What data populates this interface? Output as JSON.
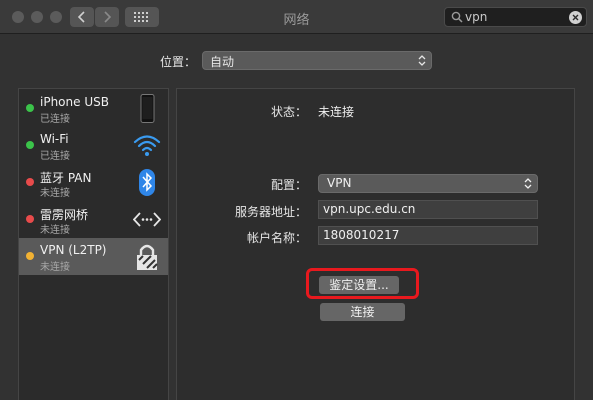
{
  "window": {
    "title": "网络",
    "search_value": "vpn"
  },
  "location": {
    "label": "位置：",
    "value": "自动"
  },
  "services": [
    {
      "name": "iPhone USB",
      "status": "已连接",
      "status_color": "#3bc34a",
      "icon": "iphone-icon"
    },
    {
      "name": "Wi-Fi",
      "status": "已连接",
      "status_color": "#3bc34a",
      "icon": "wifi-icon"
    },
    {
      "name": "蓝牙 PAN",
      "status": "未连接",
      "status_color": "#e84b4b",
      "icon": "bluetooth-icon"
    },
    {
      "name": "雷雳网桥",
      "status": "未连接",
      "status_color": "#e84b4b",
      "icon": "thunderbolt-bridge-icon"
    },
    {
      "name": "VPN (L2TP)",
      "status": "未连接",
      "status_color": "#f2b233",
      "icon": "lock-icon",
      "selected": true
    }
  ],
  "detail": {
    "status_label": "状态：",
    "status_value": "未连接",
    "config_label": "配置：",
    "config_value": "VPN",
    "server_label": "服务器地址：",
    "server_value": "vpn.upc.edu.cn",
    "account_label": "帐户名称：",
    "account_value": "1808010217",
    "auth_button": "鉴定设置...",
    "connect_button": "连接"
  },
  "colors": {
    "highlight": "#e8191e"
  }
}
